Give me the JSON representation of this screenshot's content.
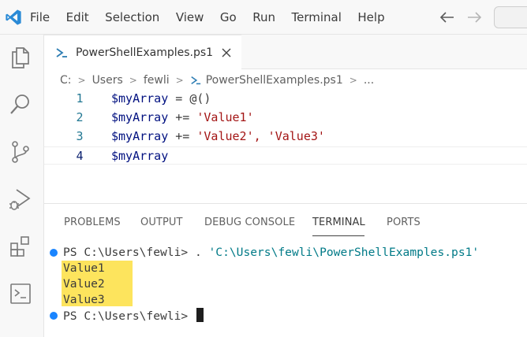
{
  "colors": {
    "accent": "#007acc",
    "string": "#a31515",
    "variable": "#001080",
    "line_number": "#237893",
    "terminal_path": "#007a87",
    "highlight": "#fde45d",
    "status_dot": "#1a85ff"
  },
  "menu": {
    "items": [
      "File",
      "Edit",
      "Selection",
      "View",
      "Go",
      "Run",
      "Terminal",
      "Help"
    ]
  },
  "icons": {
    "logo": "vscode-logo-icon",
    "activity": [
      "explorer-icon",
      "search-icon",
      "source-control-icon",
      "run-debug-icon",
      "extensions-icon",
      "remote-explorer-icon"
    ]
  },
  "tab": {
    "label": "PowerShellExamples.ps1"
  },
  "breadcrumb": {
    "items": [
      "C:",
      "Users",
      "fewli",
      "PowerShellExamples.ps1",
      "..."
    ]
  },
  "editor": {
    "lines": [
      {
        "number": "1",
        "var": "$myArray",
        "op": " = @()",
        "str": "",
        "rest": ""
      },
      {
        "number": "2",
        "var": "$myArray",
        "op": " += ",
        "str": "'Value1'",
        "rest": ""
      },
      {
        "number": "3",
        "var": "$myArray",
        "op": " += ",
        "str": "'Value2'",
        "rest": ", 'Value3'"
      },
      {
        "number": "4",
        "var": "$myArray",
        "op": "",
        "str": "",
        "rest": ""
      }
    ]
  },
  "panel": {
    "tabs": [
      "PROBLEMS",
      "OUTPUT",
      "DEBUG CONSOLE",
      "TERMINAL",
      "PORTS"
    ],
    "active_tab": "TERMINAL"
  },
  "terminal": {
    "prompt": "PS C:\\Users\\fewli>",
    "command_dot": " . ",
    "command_path": "'C:\\Users\\fewli\\PowerShellExamples.ps1'",
    "output": [
      "Value1",
      "Value2",
      "Value3"
    ],
    "prompt2": "PS C:\\Users\\fewli>"
  }
}
